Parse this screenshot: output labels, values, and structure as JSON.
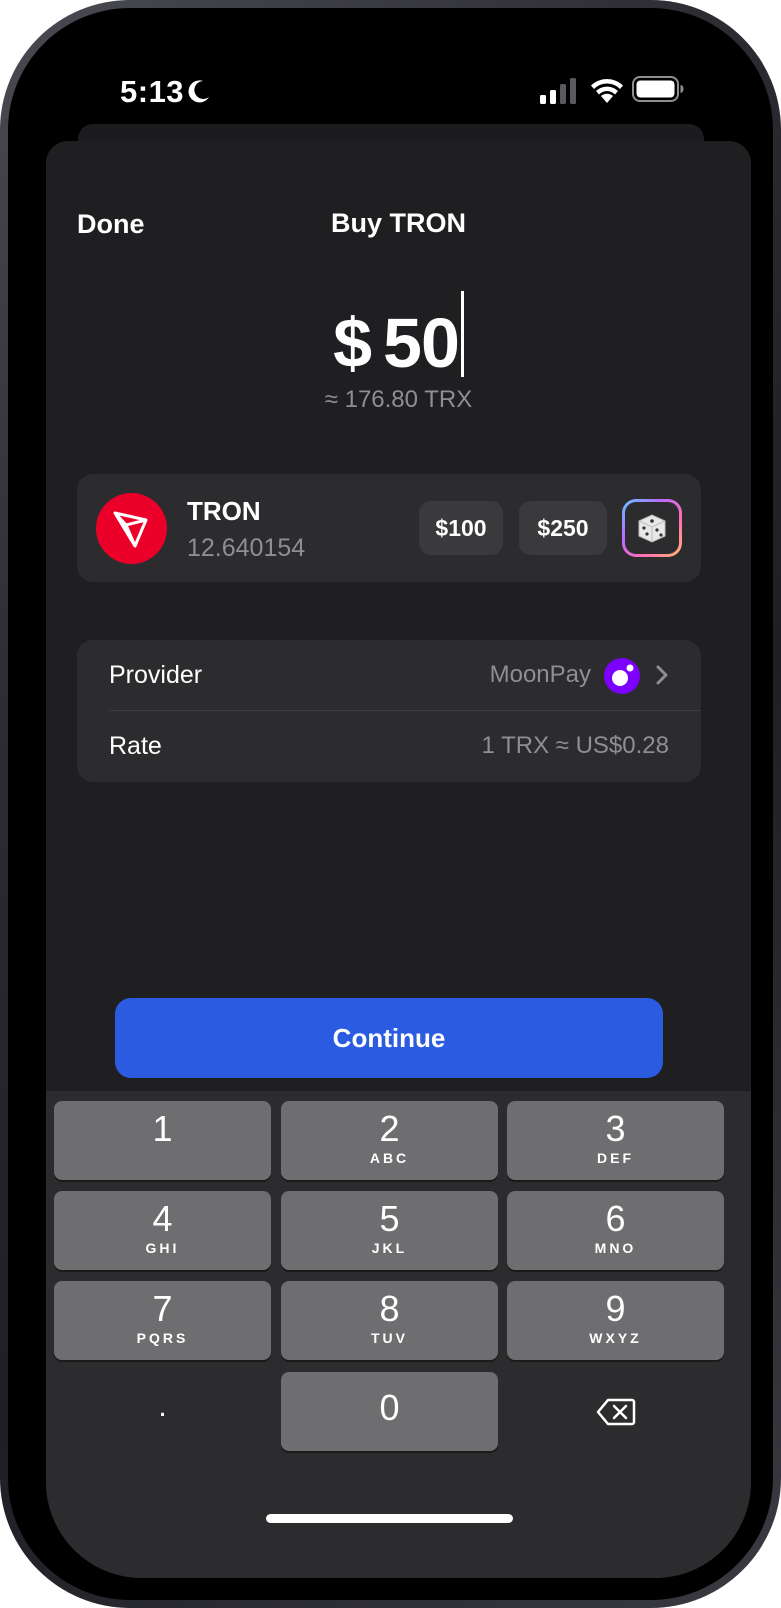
{
  "status": {
    "time": "5:13",
    "icons": [
      "moon-icon",
      "cellular-signal-icon",
      "wifi-icon",
      "battery-icon"
    ]
  },
  "header": {
    "done_label": "Done",
    "title": "Buy TRON"
  },
  "amount": {
    "currency": "$",
    "value": "50",
    "approx": "≈ 176.80 TRX"
  },
  "asset": {
    "name": "TRON",
    "balance": "12.640154",
    "logo_color": "#eb0029",
    "presets": [
      "$100",
      "$250"
    ],
    "random_icon": "dice-icon"
  },
  "info": {
    "provider_label": "Provider",
    "provider_value": "MoonPay",
    "rate_label": "Rate",
    "rate_value": "1 TRX ≈ US$0.28"
  },
  "continue_label": "Continue",
  "keypad": {
    "keys": [
      {
        "num": "1",
        "letters": ""
      },
      {
        "num": "2",
        "letters": "ABC"
      },
      {
        "num": "3",
        "letters": "DEF"
      },
      {
        "num": "4",
        "letters": "GHI"
      },
      {
        "num": "5",
        "letters": "JKL"
      },
      {
        "num": "6",
        "letters": "MNO"
      },
      {
        "num": "7",
        "letters": "PQRS"
      },
      {
        "num": "8",
        "letters": "TUV"
      },
      {
        "num": "9",
        "letters": "WXYZ"
      },
      {
        "num": "0",
        "letters": ""
      }
    ],
    "decimal": ".",
    "backspace_icon": "backspace-icon"
  },
  "colors": {
    "accent": "#2b5be0",
    "sheet": "#1f1f21",
    "card": "#2c2c2e",
    "moonpay": "#7d00ff"
  }
}
